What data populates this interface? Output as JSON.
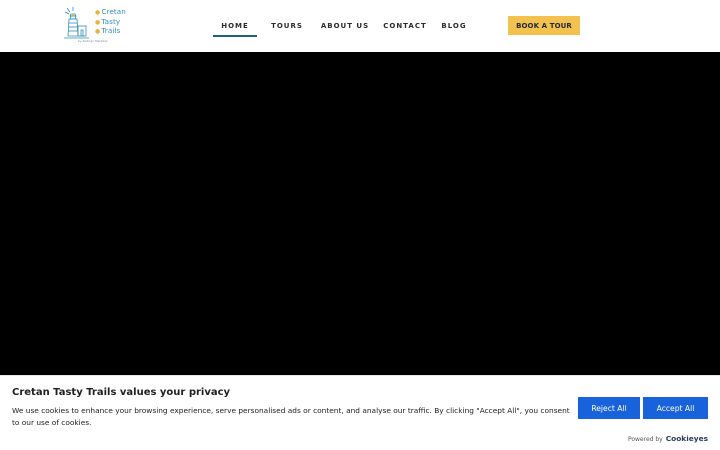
{
  "header": {
    "logo": {
      "lines": [
        "Cretan",
        "Tasty",
        "Trails"
      ],
      "tagline": "by Rodrigo Mentzos"
    },
    "nav": [
      {
        "label": "HOME",
        "active": true
      },
      {
        "label": "TOURS",
        "active": false
      },
      {
        "label": "ABOUT US",
        "active": false
      },
      {
        "label": "CONTACT",
        "active": false
      },
      {
        "label": "BLOG",
        "active": false
      }
    ],
    "cta_label": "BOOK A TOUR"
  },
  "cookie_banner": {
    "title": "Cretan Tasty Trails values your privacy",
    "description": "We use cookies to enhance your browsing experience, serve personalised ads or content, and analyse our traffic. By clicking \"Accept All\", you consent to our use of cookies.",
    "reject_label": "Reject All",
    "accept_label": "Accept All",
    "powered_by": "Powered by",
    "brand": "Cookieyes"
  },
  "colors": {
    "accent_blue": "#1863dc",
    "cta_yellow": "#f2c14e",
    "nav_underline": "#1f5f78",
    "logo_blue": "#2f8fb4"
  }
}
